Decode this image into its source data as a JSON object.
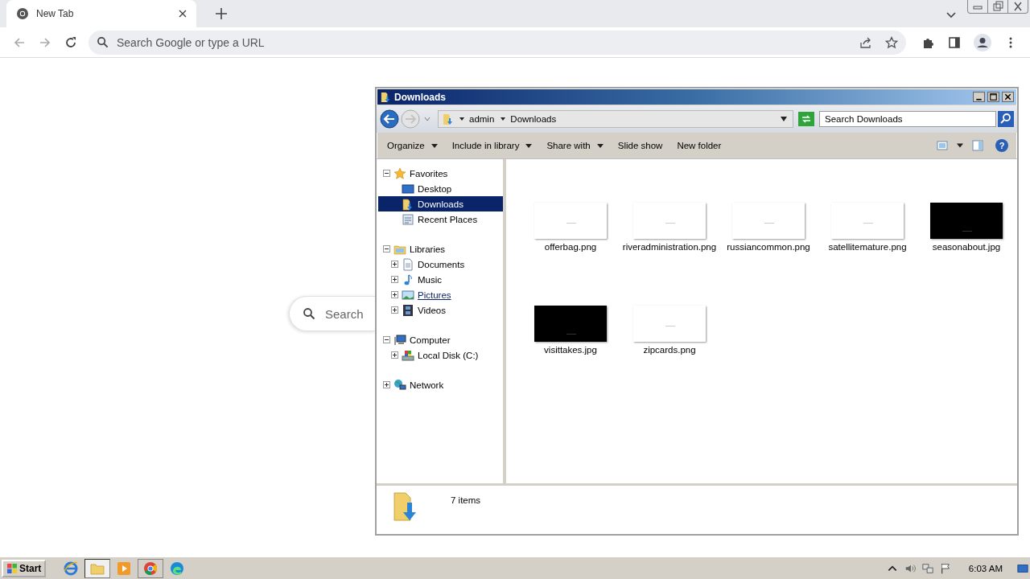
{
  "browser": {
    "tabs": [
      {
        "title": "New Tab",
        "selected": true
      }
    ],
    "omnibox": {
      "placeholder": "Search Google or type a URL"
    },
    "page_search": {
      "placeholder": "Search"
    }
  },
  "explorer": {
    "title": "Downloads",
    "breadcrumbs": [
      "admin",
      "Downloads"
    ],
    "search": {
      "placeholder": "Search Downloads"
    },
    "toolbar": [
      {
        "label": "Organize",
        "dropdown": true
      },
      {
        "label": "Include in library",
        "dropdown": true
      },
      {
        "label": "Share with",
        "dropdown": true
      },
      {
        "label": "Slide show",
        "dropdown": false
      },
      {
        "label": "New folder",
        "dropdown": false
      }
    ],
    "nav": [
      {
        "label": "Favorites",
        "kind": "star",
        "expanded": true,
        "selected": false,
        "hovered": false,
        "children": [
          {
            "label": "Desktop",
            "kind": "desktop",
            "selected": false,
            "hovered": false
          },
          {
            "label": "Downloads",
            "kind": "download",
            "selected": true,
            "hovered": false
          },
          {
            "label": "Recent Places",
            "kind": "recent",
            "selected": false,
            "hovered": false
          }
        ]
      },
      {
        "label": "Libraries",
        "kind": "library",
        "expanded": true,
        "selected": false,
        "hovered": false,
        "children": [
          {
            "label": "Documents",
            "kind": "document",
            "expanded": false,
            "selected": false,
            "hovered": false
          },
          {
            "label": "Music",
            "kind": "music",
            "expanded": false,
            "selected": false,
            "hovered": false
          },
          {
            "label": "Pictures",
            "kind": "pictures",
            "expanded": false,
            "selected": false,
            "hovered": true
          },
          {
            "label": "Videos",
            "kind": "video",
            "expanded": false,
            "selected": false,
            "hovered": false
          }
        ]
      },
      {
        "label": "Computer",
        "kind": "computer",
        "expanded": true,
        "selected": false,
        "hovered": false,
        "children": [
          {
            "label": "Local Disk (C:)",
            "kind": "disk",
            "expanded": false,
            "selected": false,
            "hovered": false
          }
        ]
      },
      {
        "label": "Network",
        "kind": "network",
        "expanded": false,
        "selected": false,
        "hovered": false
      }
    ],
    "files": [
      {
        "name": "offerbag.png",
        "kind": "light"
      },
      {
        "name": "riveradministration.png",
        "kind": "light"
      },
      {
        "name": "russiancommon.png",
        "kind": "light"
      },
      {
        "name": "satellitemature.png",
        "kind": "light"
      },
      {
        "name": "seasonabout.jpg",
        "kind": "dark"
      },
      {
        "name": "visittakes.jpg",
        "kind": "dark"
      },
      {
        "name": "zipcards.png",
        "kind": "light"
      }
    ],
    "help": "?",
    "status": "7 items"
  },
  "taskbar": {
    "start": "Start",
    "clock": "6:03 AM"
  }
}
